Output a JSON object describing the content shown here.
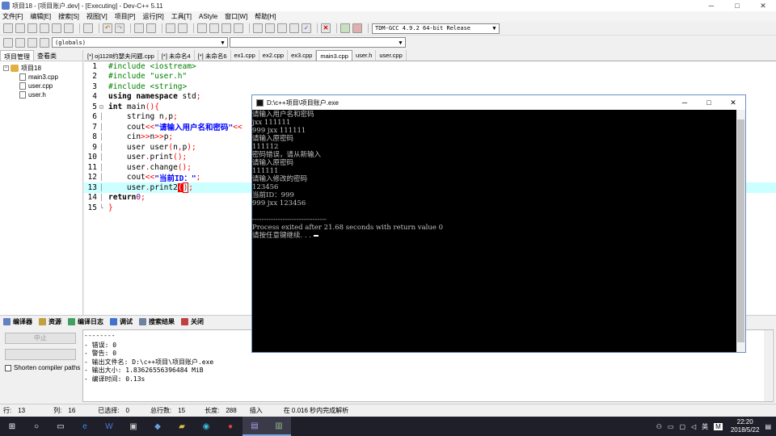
{
  "titlebar": {
    "title": "项目18 - [项目账户.dev] - [Executing] - Dev-C++ 5.11",
    "minimize": "─",
    "maximize": "□",
    "close": "✕"
  },
  "menu": [
    "文件[F]",
    "编辑[E]",
    "搜索[S]",
    "视图[V]",
    "项目[P]",
    "运行[R]",
    "工具[T]",
    "AStyle",
    "窗口[W]",
    "帮助[H]"
  ],
  "toolbar": {
    "compiler": "TDM-GCC 4.9.2 64-bit Release",
    "scope": "(globals)"
  },
  "leftpanel": {
    "tabs": [
      "项目管理",
      "查看类"
    ],
    "project": "项目18",
    "files": [
      "main3.cpp",
      "user.cpp",
      "user.h"
    ]
  },
  "editor": {
    "tabs": [
      "[*] oj1128约瑟夫问题.cpp",
      "[*] 未命名4",
      "[*] 未命名6",
      "ex1.cpp",
      "ex2.cpp",
      "ex3.cpp",
      "main3.cpp",
      "user.h",
      "user.cpp"
    ],
    "active_tab": "main3.cpp"
  },
  "console": {
    "title": "D:\\c++项目\\项目账户.exe",
    "lines": [
      "请输入用户名和密码",
      "jxx 111111",
      "999 jxx 111111",
      "请输入原密码",
      "111112",
      "密码错误，请从新输入",
      "请输入原密码",
      "111111",
      "请输入修改的密码",
      "123456",
      "当前ID：999",
      "999 jxx 123456",
      "",
      "--------------------------------",
      "Process exited after 21.68 seconds with return value 0",
      "请按任意键继续. . . "
    ]
  },
  "bottom": {
    "tabs": [
      "编译器",
      "资源",
      "编译日志",
      "调试",
      "搜索结果",
      "关闭"
    ],
    "abort_label": "中止",
    "shorten_label": "Shorten compiler paths",
    "log": [
      "--------",
      "- 错误: 0",
      "- 警告: 0",
      "- 输出文件名: D:\\c++项目\\项目账户.exe",
      "- 输出大小: 1.83626556396484 MiB",
      "- 编译时间: 0.13s"
    ]
  },
  "status": {
    "row_label": "行:",
    "row": "13",
    "col_label": "列:",
    "col": "16",
    "sel_label": "已选择:",
    "sel": "0",
    "lines_label": "总行数:",
    "lines": "15",
    "len_label": "长度:",
    "len": "288",
    "mode": "插入",
    "parse": "在 0.016 秒内完成解析"
  },
  "taskbar": {
    "lang": "英",
    "ime": "M",
    "time": "22:20",
    "date": "2018/5/22"
  }
}
